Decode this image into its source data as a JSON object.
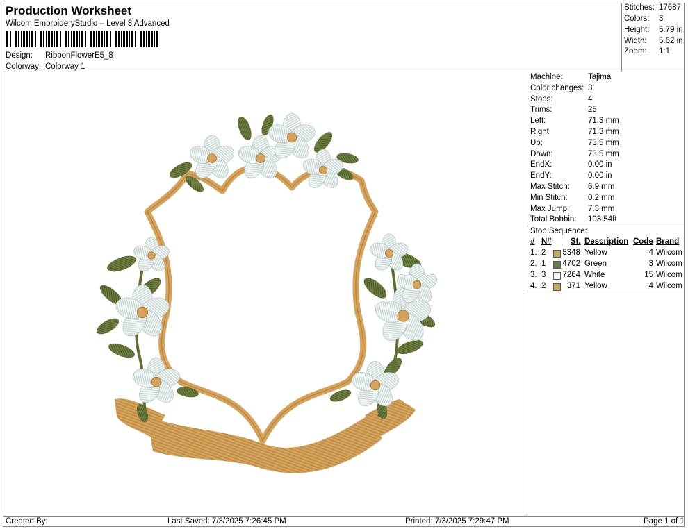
{
  "header": {
    "title": "Production Worksheet",
    "software": "Wilcom EmbroideryStudio – Level 3 Advanced",
    "design_label": "Design:",
    "design_value": "RibbonFlowerE5_8",
    "colorway_label": "Colorway:",
    "colorway_value": "Colorway 1"
  },
  "summary": [
    {
      "label": "Stitches:",
      "value": "17687"
    },
    {
      "label": "Colors:",
      "value": "3"
    },
    {
      "label": "Height:",
      "value": "5.79 in"
    },
    {
      "label": "Width:",
      "value": "5.62 in"
    },
    {
      "label": "Zoom:",
      "value": "1:1"
    }
  ],
  "machine_info": [
    {
      "label": "Machine:",
      "value": "Tajima"
    },
    {
      "label": "Color changes:",
      "value": "3"
    },
    {
      "label": "Stops:",
      "value": "4"
    },
    {
      "label": "Trims:",
      "value": "25"
    },
    {
      "label": "Left:",
      "value": "71.3 mm"
    },
    {
      "label": "Right:",
      "value": "71.3 mm"
    },
    {
      "label": "Up:",
      "value": "73.5 mm"
    },
    {
      "label": "Down:",
      "value": "73.5 mm"
    },
    {
      "label": "EndX:",
      "value": "0.00 in"
    },
    {
      "label": "EndY:",
      "value": "0.00 in"
    },
    {
      "label": "Max Stitch:",
      "value": "6.9 mm"
    },
    {
      "label": "Min Stitch:",
      "value": "0.2 mm"
    },
    {
      "label": "Max Jump:",
      "value": "7.3 mm"
    },
    {
      "label": "Total Bobbin:",
      "value": "103.54ft"
    }
  ],
  "stop_sequence": {
    "title": "Stop Sequence:",
    "headers": {
      "num": "#",
      "n": "N#",
      "st": "St.",
      "desc": "Description",
      "code": "Code",
      "brand": "Brand"
    },
    "rows": [
      {
        "num": "1.",
        "n": "2",
        "color": "#D4A35F",
        "st": "5348",
        "desc": "Yellow",
        "code": "4",
        "brand": "Wilcom"
      },
      {
        "num": "2.",
        "n": "1",
        "color": "#6B7A3A",
        "st": "4702",
        "desc": "Green",
        "code": "3",
        "brand": "Wilcom"
      },
      {
        "num": "3.",
        "n": "3",
        "color": "#FFFFFF",
        "st": "7264",
        "desc": "White",
        "code": "15",
        "brand": "Wilcom"
      },
      {
        "num": "4.",
        "n": "2",
        "color": "#D4A35F",
        "st": "371",
        "desc": "Yellow",
        "code": "4",
        "brand": "Wilcom"
      }
    ]
  },
  "footer": {
    "created_by": "Created By:",
    "last_saved": "Last Saved: 7/3/2025 7:26:45 PM",
    "printed": "Printed: 7/3/2025 7:29:47 PM",
    "page": "Page 1 of 1"
  },
  "colors": {
    "gold": "#D4A35F",
    "green": "#6B7A3A",
    "white_flower": "#E8F0EE"
  }
}
